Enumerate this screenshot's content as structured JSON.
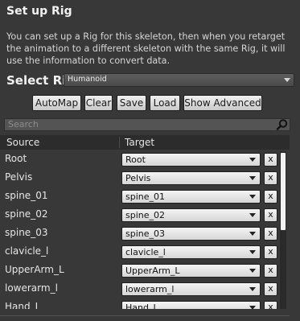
{
  "panel": {
    "title": "Set up Rig",
    "description": "You can set up a Rig for this skeleton, then when you retarget the animation to a different skeleton with the same Rig, it will use the information to convert data."
  },
  "select_rig": {
    "label": "Select Rig",
    "value": "Humanoid"
  },
  "buttons": {
    "automap": "AutoMap",
    "clear": "Clear",
    "save": "Save",
    "load": "Load",
    "show_advanced": "Show Advanced"
  },
  "search": {
    "placeholder": "Search"
  },
  "table": {
    "headers": {
      "source": "Source",
      "target": "Target"
    },
    "clear_label": "x",
    "rows": [
      {
        "source": "Root",
        "target": "Root"
      },
      {
        "source": "Pelvis",
        "target": "Pelvis"
      },
      {
        "source": "spine_01",
        "target": "spine_01"
      },
      {
        "source": "spine_02",
        "target": "spine_02"
      },
      {
        "source": "spine_03",
        "target": "spine_03"
      },
      {
        "source": "clavicle_l",
        "target": "clavicle_l"
      },
      {
        "source": "UpperArm_L",
        "target": "UpperArm_L"
      },
      {
        "source": "lowerarm_l",
        "target": "lowerarm_l"
      },
      {
        "source": "Hand_L",
        "target": "Hand_L"
      }
    ]
  },
  "scrollbar": {
    "visible_fraction": 0.5,
    "position": 0
  }
}
